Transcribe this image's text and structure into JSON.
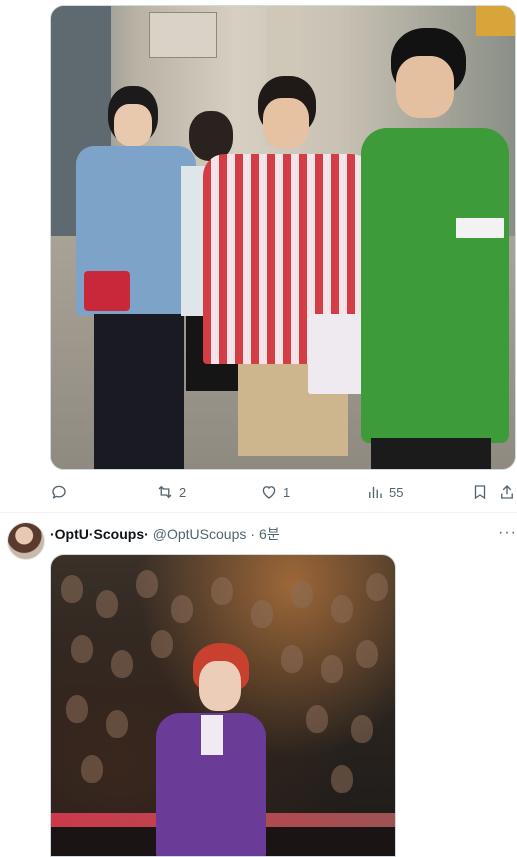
{
  "post1": {
    "actions": {
      "reply_count": "",
      "retweet_count": "2",
      "like_count": "1",
      "view_count": "55"
    }
  },
  "post2": {
    "author": {
      "display_name": "·OptU·Scoups·",
      "handle": "@OptUScoups",
      "separator": "·",
      "time": "6분"
    },
    "more_label": "···"
  },
  "colors": {
    "icon": "#536471",
    "divider": "#eff3f4",
    "text_primary": "#0f1419"
  }
}
